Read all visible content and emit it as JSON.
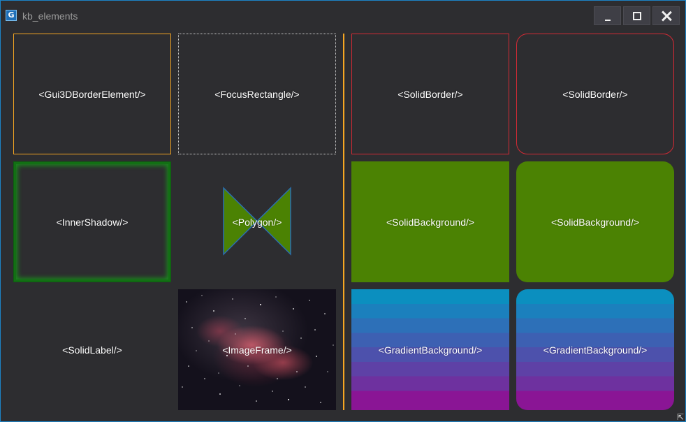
{
  "window": {
    "title": "kb_elements",
    "icon": "app-icon",
    "icon_glyph": "G",
    "buttons": {
      "minimize": "minimize-icon",
      "maximize": "maximize-icon",
      "close": "close-icon"
    }
  },
  "cells": {
    "gui3d_border": "<Gui3DBorderElement/>",
    "focus_rectangle": "<FocusRectangle/>",
    "solid_border_square": "<SolidBorder/>",
    "solid_border_rounded": "<SolidBorder/>",
    "inner_shadow": "<InnerShadow/>",
    "polygon": "<Polygon/>",
    "solid_background_square": "<SolidBackground/>",
    "solid_background_rounded": "<SolidBackground/>",
    "solid_label": "<SolidLabel/>",
    "image_frame": "<ImageFrame/>",
    "gradient_background_square": "<GradientBackground/>",
    "gradient_background_rounded": "<GradientBackground/>"
  },
  "colors": {
    "window_background": "#2d2d30",
    "window_border": "#1c84c6",
    "gui3d_border": "#f5a623",
    "solid_border": "#d42a35",
    "inner_shadow": "#1b8a1d",
    "polygon_fill": "#4b8203",
    "polygon_stroke": "#2a6fb0",
    "solid_background": "#4b8203",
    "gradient_top": "#0b8fbf",
    "gradient_bottom": "#8a1595",
    "separator": "#f5a623"
  }
}
